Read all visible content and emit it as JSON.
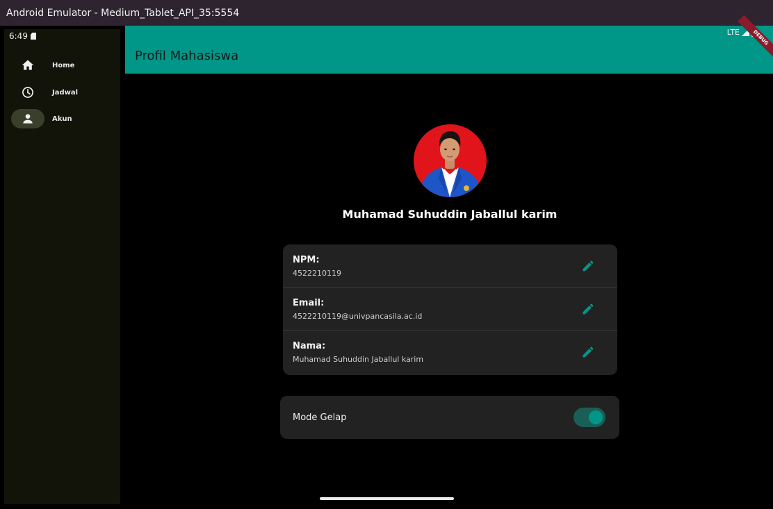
{
  "window": {
    "title": "Android Emulator - Medium_Tablet_API_35:5554"
  },
  "status_bar": {
    "time": "6:49",
    "network": "LTE"
  },
  "debug_banner": "DEBUG",
  "nav_rail": {
    "items": [
      {
        "label": "Home",
        "icon": "home-icon",
        "active": false
      },
      {
        "label": "Jadwal",
        "icon": "clock-icon",
        "active": false
      },
      {
        "label": "Akun",
        "icon": "person-icon",
        "active": true
      }
    ]
  },
  "app_bar": {
    "title": "Profil Mahasiswa"
  },
  "profile": {
    "name": "Muhamad Suhuddin Jaballul karim",
    "avatar": "profile-photo"
  },
  "info": {
    "rows": [
      {
        "label": "NPM:",
        "value": "4522210119"
      },
      {
        "label": "Email:",
        "value": "4522210119@univpancasila.ac.id"
      },
      {
        "label": "Nama:",
        "value": "Muhamad Suhuddin Jaballul karim"
      }
    ]
  },
  "theme": {
    "label": "Mode Gelap",
    "enabled": true
  },
  "colors": {
    "accent": "#009688",
    "rail_bg": "#12140a",
    "card_bg": "#222222",
    "avatar_bg": "#e0141a",
    "jacket": "#1e56c8"
  }
}
